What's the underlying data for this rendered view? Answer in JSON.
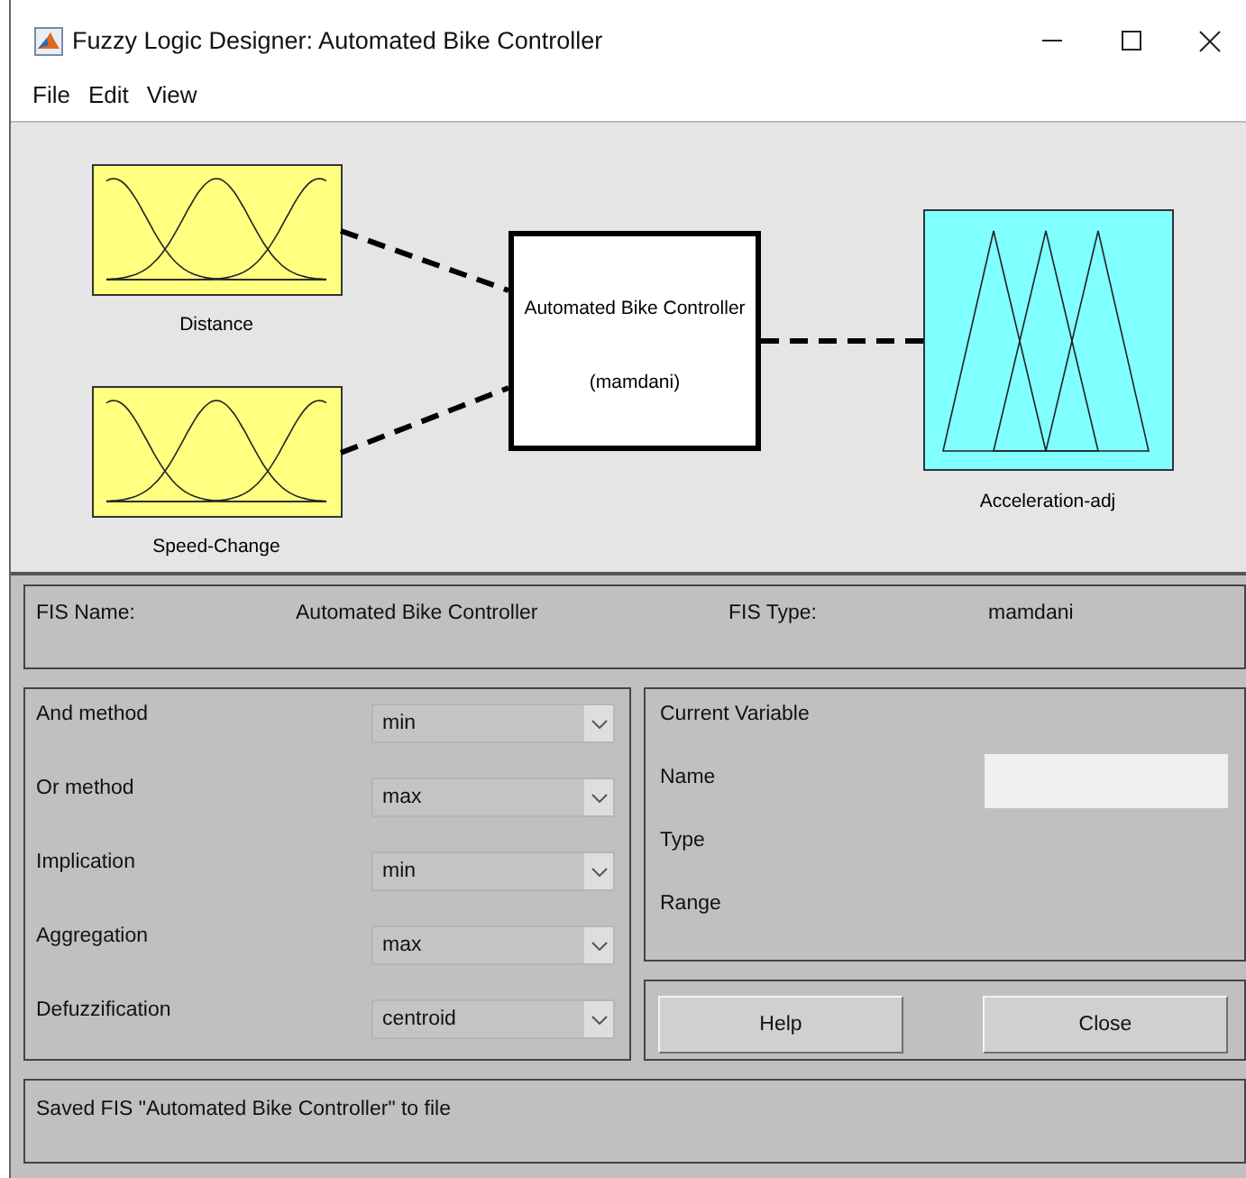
{
  "window": {
    "title": "Fuzzy Logic Designer: Automated Bike Controller"
  },
  "menu": [
    "File",
    "Edit",
    "View"
  ],
  "inputs": [
    {
      "name": "Distance",
      "kind": "gauss"
    },
    {
      "name": "Speed-Change",
      "kind": "gauss"
    }
  ],
  "system": {
    "name": "Automated Bike Controller",
    "type": "(mamdani)"
  },
  "outputs": [
    {
      "name": "Acceleration-adj",
      "kind": "triangle"
    }
  ],
  "fis": {
    "name_label": "FIS Name:",
    "name": "Automated Bike Controller",
    "type_label": "FIS Type:",
    "type": "mamdani"
  },
  "methods": [
    {
      "label": "And method",
      "value": "min"
    },
    {
      "label": "Or method",
      "value": "max"
    },
    {
      "label": "Implication",
      "value": "min"
    },
    {
      "label": "Aggregation",
      "value": "max"
    },
    {
      "label": "Defuzzification",
      "value": "centroid"
    }
  ],
  "current_variable": {
    "title": "Current Variable",
    "fields": [
      {
        "label": "Name",
        "kind": "field"
      },
      {
        "label": "Type",
        "kind": "text"
      },
      {
        "label": "Range",
        "kind": "text"
      }
    ]
  },
  "buttons": [
    "Help",
    "Close"
  ],
  "status": "Saved FIS \"Automated Bike Controller\" to file"
}
